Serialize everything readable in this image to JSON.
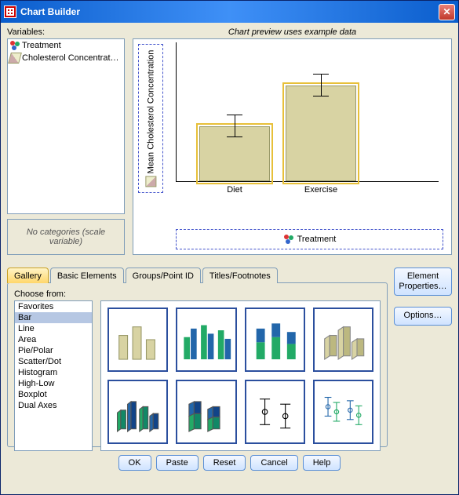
{
  "window": {
    "title": "Chart Builder"
  },
  "labels": {
    "variables": "Variables:",
    "preview": "Chart preview uses example data",
    "no_categories": "No categories (scale variable)",
    "choose_from": "Choose from:",
    "yaxis": "Mean Cholesterol Concentration"
  },
  "variables": [
    {
      "name": "Treatment",
      "icon": "nominal"
    },
    {
      "name": "Cholesterol Concentrat…",
      "icon": "scale"
    }
  ],
  "tabs": [
    {
      "id": "gallery",
      "label": "Gallery",
      "active": true
    },
    {
      "id": "basic",
      "label": "Basic Elements",
      "active": false
    },
    {
      "id": "groups",
      "label": "Groups/Point ID",
      "active": false
    },
    {
      "id": "titles",
      "label": "Titles/Footnotes",
      "active": false
    }
  ],
  "side_buttons": {
    "element_properties": "Element Properties…",
    "options": "Options…"
  },
  "gallery_types": [
    "Favorites",
    "Bar",
    "Line",
    "Area",
    "Pie/Polar",
    "Scatter/Dot",
    "Histogram",
    "High-Low",
    "Boxplot",
    "Dual Axes"
  ],
  "gallery_selected": "Bar",
  "thumb_names": [
    "simple-bar",
    "clustered-bar",
    "stacked-bar",
    "3d-bar",
    "clustered-3d-bar",
    "stacked-3d-bar",
    "simple-error-bar",
    "clustered-error-bar"
  ],
  "buttons": {
    "ok": "OK",
    "paste": "Paste",
    "reset": "Reset",
    "cancel": "Cancel",
    "help": "Help"
  },
  "chart_data": {
    "type": "bar",
    "title": "",
    "xlabel": "Treatment",
    "ylabel": "Mean Cholesterol Concentration",
    "categories": [
      "Diet",
      "Exercise"
    ],
    "values": [
      40,
      70
    ],
    "error": [
      8,
      8
    ],
    "ylim": [
      0,
      100
    ]
  }
}
